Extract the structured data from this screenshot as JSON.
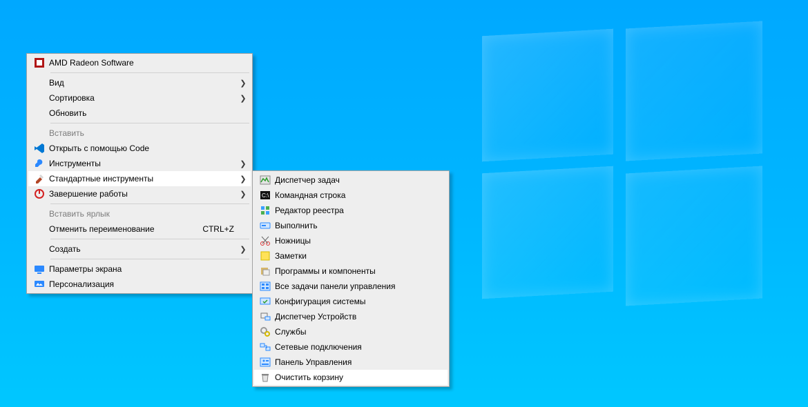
{
  "context_menu": {
    "items": [
      {
        "label": "AMD Radeon Software",
        "icon": "amd-icon"
      },
      {
        "sep": true
      },
      {
        "label": "Вид",
        "submenu": true
      },
      {
        "label": "Сортировка",
        "submenu": true
      },
      {
        "label": "Обновить"
      },
      {
        "sep": true
      },
      {
        "label": "Вставить",
        "disabled": true
      },
      {
        "label": "Открыть с помощью Code",
        "icon": "vscode-icon"
      },
      {
        "label": "Инструменты",
        "icon": "tool-icon",
        "submenu": true
      },
      {
        "label": "Стандартные инструменты",
        "icon": "std-tools-icon",
        "submenu": true,
        "highlighted": true
      },
      {
        "label": "Завершение работы",
        "icon": "shutdown-icon",
        "submenu": true
      },
      {
        "sep": true
      },
      {
        "label": "Вставить ярлык",
        "disabled": true
      },
      {
        "label": "Отменить переименование",
        "shortcut": "CTRL+Z"
      },
      {
        "sep": true
      },
      {
        "label": "Создать",
        "submenu": true
      },
      {
        "sep": true
      },
      {
        "label": "Параметры экрана",
        "icon": "display-settings-icon"
      },
      {
        "label": "Персонализация",
        "icon": "personalize-icon"
      }
    ]
  },
  "submenu_std_tools": {
    "items": [
      {
        "label": "Диспетчер задач",
        "icon": "taskmgr-icon"
      },
      {
        "label": "Командная строка",
        "icon": "cmd-icon"
      },
      {
        "label": "Редактор реестра",
        "icon": "regedit-icon"
      },
      {
        "label": "Выполнить",
        "icon": "run-icon"
      },
      {
        "label": "Ножницы",
        "icon": "snip-icon"
      },
      {
        "label": "Заметки",
        "icon": "notes-icon"
      },
      {
        "label": "Программы и компоненты",
        "icon": "programs-icon"
      },
      {
        "label": "Все задачи панели управления",
        "icon": "alltasks-icon"
      },
      {
        "label": "Конфигурация системы",
        "icon": "msconfig-icon"
      },
      {
        "label": "Диспетчер Устройств",
        "icon": "devmgr-icon"
      },
      {
        "label": "Службы",
        "icon": "services-icon"
      },
      {
        "label": "Сетевые подключения",
        "icon": "netconn-icon"
      },
      {
        "label": "Панель Управления",
        "icon": "cpanel-icon"
      },
      {
        "label": "Очистить корзину",
        "icon": "clean-bin-icon",
        "highlighted": true
      }
    ]
  }
}
